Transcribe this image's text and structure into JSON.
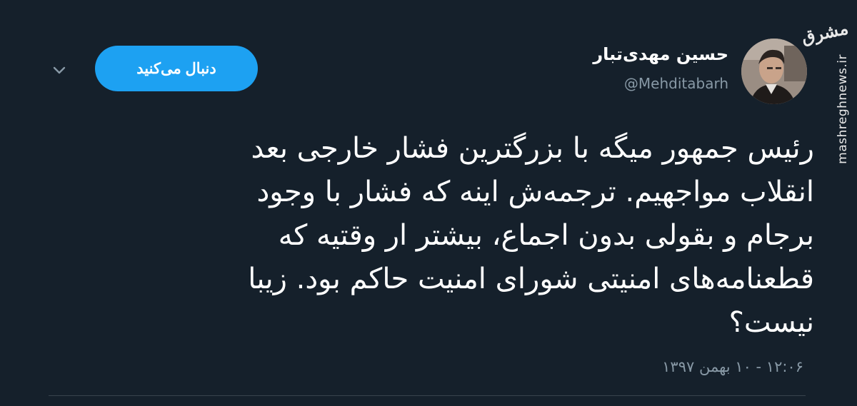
{
  "watermark": {
    "logo": "مشرق",
    "site": "mashreghnews.ir"
  },
  "author": {
    "display_name": "حسین مهدی‌تبار",
    "handle": "@Mehditabarh"
  },
  "follow_button": {
    "label": "دنبال می‌کنید"
  },
  "menu": {
    "icon": "chevron-down-icon"
  },
  "tweet": {
    "lines": [
      "رئیس جمهور میگه با بزرگترین فشار خارجی بعد",
      "انقلاب مواجهیم. ترجمه‌ش اینه که فشار با وجود",
      "برجام و بقولی بدون اجماع، بیشتر ار وقتیه که",
      "قطعنامه‌های امنیتی شورای امنیت حاکم بود. زیبا",
      "نیست؟"
    ],
    "timestamp": "۱۲:۰۶ - ۱۰ بهمن ۱۳۹۷"
  },
  "colors": {
    "background": "#15202b",
    "accent": "#1da1f2",
    "secondary_text": "#8899a6",
    "divider": "#38444d"
  }
}
